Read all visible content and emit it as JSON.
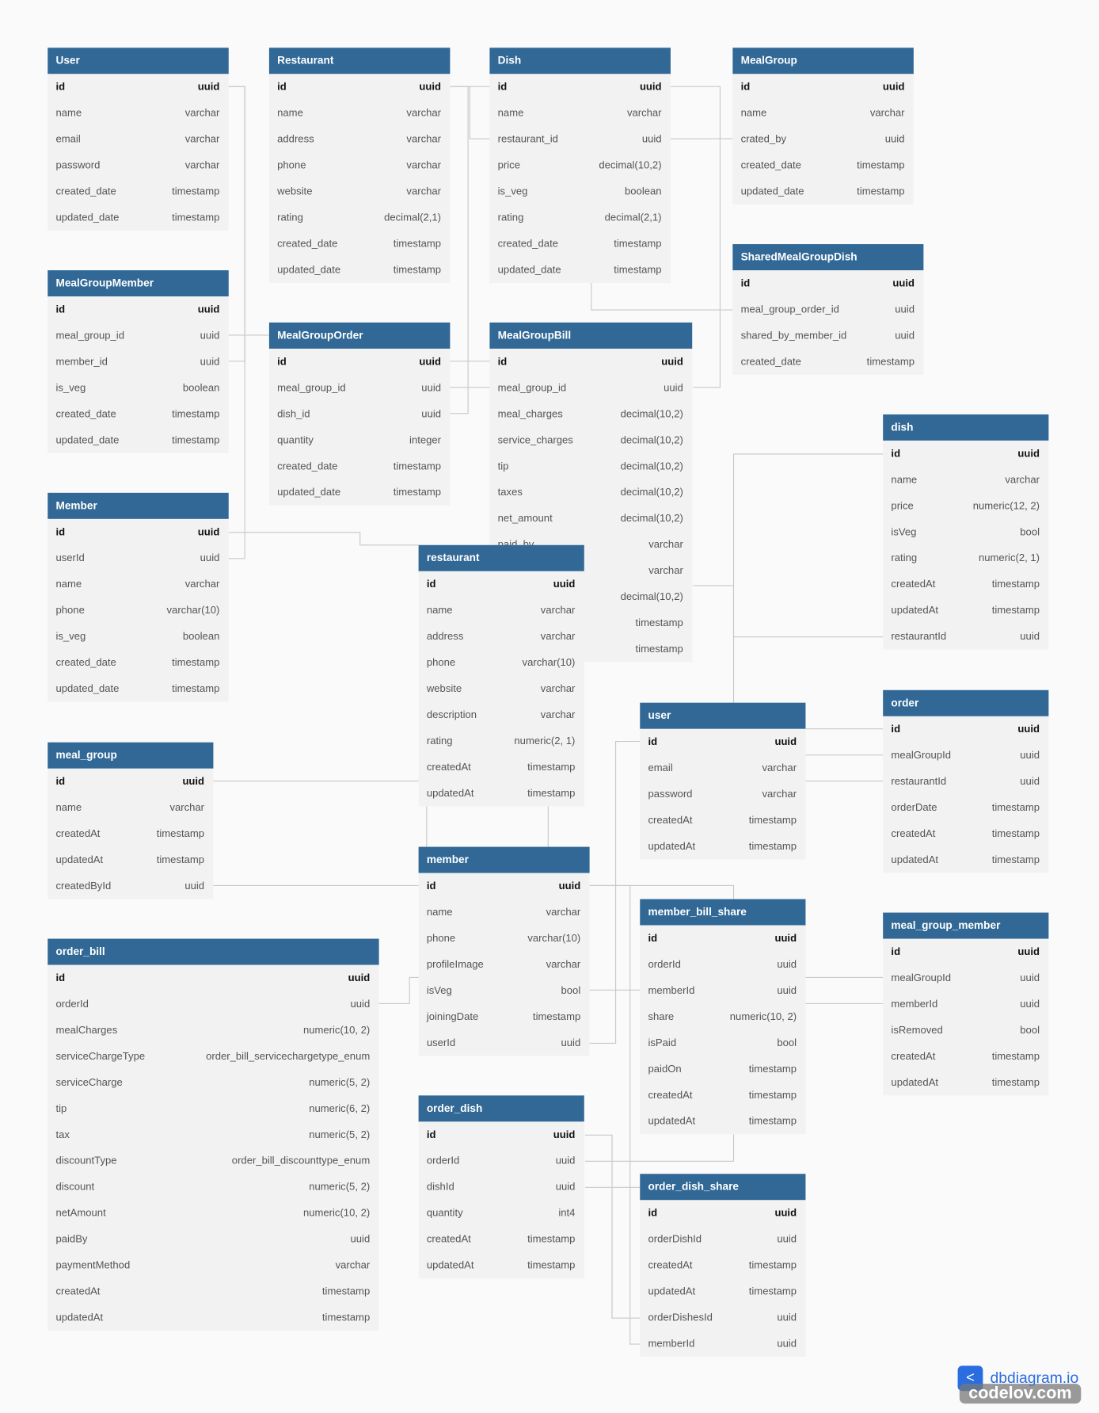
{
  "colors": {
    "header": "#316896",
    "body": "#f2f2f2",
    "line": "#c8c8c8"
  },
  "tables": [
    {
      "name": "User",
      "fields": [
        [
          "id",
          "uuid"
        ],
        [
          "name",
          "varchar"
        ],
        [
          "email",
          "varchar"
        ],
        [
          "password",
          "varchar"
        ],
        [
          "created_date",
          "timestamp"
        ],
        [
          "updated_date",
          "timestamp"
        ]
      ]
    },
    {
      "name": "Restaurant",
      "fields": [
        [
          "id",
          "uuid"
        ],
        [
          "name",
          "varchar"
        ],
        [
          "address",
          "varchar"
        ],
        [
          "phone",
          "varchar"
        ],
        [
          "website",
          "varchar"
        ],
        [
          "rating",
          "decimal(2,1)"
        ],
        [
          "created_date",
          "timestamp"
        ],
        [
          "updated_date",
          "timestamp"
        ]
      ]
    },
    {
      "name": "Dish",
      "fields": [
        [
          "id",
          "uuid"
        ],
        [
          "name",
          "varchar"
        ],
        [
          "restaurant_id",
          "uuid"
        ],
        [
          "price",
          "decimal(10,2)"
        ],
        [
          "is_veg",
          "boolean"
        ],
        [
          "rating",
          "decimal(2,1)"
        ],
        [
          "created_date",
          "timestamp"
        ],
        [
          "updated_date",
          "timestamp"
        ]
      ]
    },
    {
      "name": "MealGroup",
      "fields": [
        [
          "id",
          "uuid"
        ],
        [
          "name",
          "varchar"
        ],
        [
          "crated_by",
          "uuid"
        ],
        [
          "created_date",
          "timestamp"
        ],
        [
          "updated_date",
          "timestamp"
        ]
      ]
    },
    {
      "name": "SharedMealGroupDish",
      "fields": [
        [
          "id",
          "uuid"
        ],
        [
          "meal_group_order_id",
          "uuid"
        ],
        [
          "shared_by_member_id",
          "uuid"
        ],
        [
          "created_date",
          "timestamp"
        ]
      ]
    },
    {
      "name": "MealGroupMember",
      "fields": [
        [
          "id",
          "uuid"
        ],
        [
          "meal_group_id",
          "uuid"
        ],
        [
          "member_id",
          "uuid"
        ],
        [
          "is_veg",
          "boolean"
        ],
        [
          "created_date",
          "timestamp"
        ],
        [
          "updated_date",
          "timestamp"
        ]
      ]
    },
    {
      "name": "MealGroupOrder",
      "fields": [
        [
          "id",
          "uuid"
        ],
        [
          "meal_group_id",
          "uuid"
        ],
        [
          "dish_id",
          "uuid"
        ],
        [
          "quantity",
          "integer"
        ],
        [
          "created_date",
          "timestamp"
        ],
        [
          "updated_date",
          "timestamp"
        ]
      ]
    },
    {
      "name": "MealGroupBill",
      "fields": [
        [
          "id",
          "uuid"
        ],
        [
          "meal_group_id",
          "uuid"
        ],
        [
          "meal_charges",
          "decimal(10,2)"
        ],
        [
          "service_charges",
          "decimal(10,2)"
        ],
        [
          "tip",
          "decimal(10,2)"
        ],
        [
          "taxes",
          "decimal(10,2)"
        ],
        [
          "net_amount",
          "decimal(10,2)"
        ],
        [
          "paid_by",
          "varchar"
        ],
        [
          "",
          "varchar"
        ],
        [
          "",
          "decimal(10,2)"
        ],
        [
          "",
          "timestamp"
        ],
        [
          "",
          "timestamp"
        ]
      ]
    },
    {
      "name": "Member",
      "fields": [
        [
          "id",
          "uuid"
        ],
        [
          "userId",
          "uuid"
        ],
        [
          "name",
          "varchar"
        ],
        [
          "phone",
          "varchar(10)"
        ],
        [
          "is_veg",
          "boolean"
        ],
        [
          "created_date",
          "timestamp"
        ],
        [
          "updated_date",
          "timestamp"
        ]
      ]
    },
    {
      "name": "dish",
      "fields": [
        [
          "id",
          "uuid"
        ],
        [
          "name",
          "varchar"
        ],
        [
          "price",
          "numeric(12, 2)"
        ],
        [
          "isVeg",
          "bool"
        ],
        [
          "rating",
          "numeric(2, 1)"
        ],
        [
          "createdAt",
          "timestamp"
        ],
        [
          "updatedAt",
          "timestamp"
        ],
        [
          "restaurantId",
          "uuid"
        ]
      ]
    },
    {
      "name": "restaurant",
      "fields": [
        [
          "id",
          "uuid"
        ],
        [
          "name",
          "varchar"
        ],
        [
          "address",
          "varchar"
        ],
        [
          "phone",
          "varchar(10)"
        ],
        [
          "website",
          "varchar"
        ],
        [
          "description",
          "varchar"
        ],
        [
          "rating",
          "numeric(2, 1)"
        ],
        [
          "createdAt",
          "timestamp"
        ],
        [
          "updatedAt",
          "timestamp"
        ]
      ]
    },
    {
      "name": "order",
      "fields": [
        [
          "id",
          "uuid"
        ],
        [
          "mealGroupId",
          "uuid"
        ],
        [
          "restaurantId",
          "uuid"
        ],
        [
          "orderDate",
          "timestamp"
        ],
        [
          "createdAt",
          "timestamp"
        ],
        [
          "updatedAt",
          "timestamp"
        ]
      ]
    },
    {
      "name": "user",
      "fields": [
        [
          "id",
          "uuid"
        ],
        [
          "email",
          "varchar"
        ],
        [
          "password",
          "varchar"
        ],
        [
          "createdAt",
          "timestamp"
        ],
        [
          "updatedAt",
          "timestamp"
        ]
      ]
    },
    {
      "name": "meal_group",
      "fields": [
        [
          "id",
          "uuid"
        ],
        [
          "name",
          "varchar"
        ],
        [
          "createdAt",
          "timestamp"
        ],
        [
          "updatedAt",
          "timestamp"
        ],
        [
          "createdById",
          "uuid"
        ]
      ]
    },
    {
      "name": "member",
      "fields": [
        [
          "id",
          "uuid"
        ],
        [
          "name",
          "varchar"
        ],
        [
          "phone",
          "varchar(10)"
        ],
        [
          "profileImage",
          "varchar"
        ],
        [
          "isVeg",
          "bool"
        ],
        [
          "joiningDate",
          "timestamp"
        ],
        [
          "userId",
          "uuid"
        ]
      ]
    },
    {
      "name": "member_bill_share",
      "fields": [
        [
          "id",
          "uuid"
        ],
        [
          "orderId",
          "uuid"
        ],
        [
          "memberId",
          "uuid"
        ],
        [
          "share",
          "numeric(10, 2)"
        ],
        [
          "isPaid",
          "bool"
        ],
        [
          "paidOn",
          "timestamp"
        ],
        [
          "createdAt",
          "timestamp"
        ],
        [
          "updatedAt",
          "timestamp"
        ]
      ]
    },
    {
      "name": "meal_group_member",
      "fields": [
        [
          "id",
          "uuid"
        ],
        [
          "mealGroupId",
          "uuid"
        ],
        [
          "memberId",
          "uuid"
        ],
        [
          "isRemoved",
          "bool"
        ],
        [
          "createdAt",
          "timestamp"
        ],
        [
          "updatedAt",
          "timestamp"
        ]
      ]
    },
    {
      "name": "order_bill",
      "fields": [
        [
          "id",
          "uuid"
        ],
        [
          "orderId",
          "uuid"
        ],
        [
          "mealCharges",
          "numeric(10, 2)"
        ],
        [
          "serviceChargeType",
          "order_bill_servicechargetype_enum"
        ],
        [
          "serviceCharge",
          "numeric(5, 2)"
        ],
        [
          "tip",
          "numeric(6, 2)"
        ],
        [
          "tax",
          "numeric(5, 2)"
        ],
        [
          "discountType",
          "order_bill_discounttype_enum"
        ],
        [
          "discount",
          "numeric(5, 2)"
        ],
        [
          "netAmount",
          "numeric(10, 2)"
        ],
        [
          "paidBy",
          "uuid"
        ],
        [
          "paymentMethod",
          "varchar"
        ],
        [
          "createdAt",
          "timestamp"
        ],
        [
          "updatedAt",
          "timestamp"
        ]
      ]
    },
    {
      "name": "order_dish",
      "fields": [
        [
          "id",
          "uuid"
        ],
        [
          "orderId",
          "uuid"
        ],
        [
          "dishId",
          "uuid"
        ],
        [
          "quantity",
          "int4"
        ],
        [
          "createdAt",
          "timestamp"
        ],
        [
          "updatedAt",
          "timestamp"
        ]
      ]
    },
    {
      "name": "order_dish_share",
      "fields": [
        [
          "id",
          "uuid"
        ],
        [
          "orderDishId",
          "uuid"
        ],
        [
          "createdAt",
          "timestamp"
        ],
        [
          "updatedAt",
          "timestamp"
        ],
        [
          "orderDishesId",
          "uuid"
        ],
        [
          "memberId",
          "uuid"
        ]
      ]
    }
  ],
  "branding": {
    "logo": "dbdiagram.io",
    "watermark": "codelov.com"
  }
}
